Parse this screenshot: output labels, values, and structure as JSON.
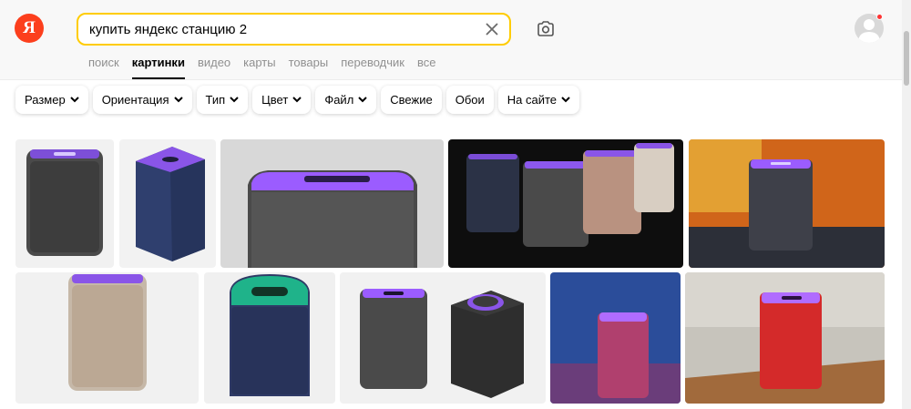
{
  "search": {
    "query": "купить яндекс станцию 2"
  },
  "logo": {
    "letter": "Я"
  },
  "tabs": [
    {
      "label": "поиск",
      "active": false
    },
    {
      "label": "картинки",
      "active": true
    },
    {
      "label": "видео",
      "active": false
    },
    {
      "label": "карты",
      "active": false
    },
    {
      "label": "товары",
      "active": false
    },
    {
      "label": "переводчик",
      "active": false
    },
    {
      "label": "все",
      "active": false
    }
  ],
  "filters": [
    {
      "label": "Размер",
      "dropdown": true
    },
    {
      "label": "Ориентация",
      "dropdown": true
    },
    {
      "label": "Тип",
      "dropdown": true
    },
    {
      "label": "Цвет",
      "dropdown": true
    },
    {
      "label": "Файл",
      "dropdown": true
    },
    {
      "label": "Свежие",
      "dropdown": false
    },
    {
      "label": "Обои",
      "dropdown": false
    },
    {
      "label": "На сайте",
      "dropdown": true
    }
  ],
  "icons": {
    "clear": "close-icon",
    "camera": "camera-search-icon",
    "avatar": "user-avatar-icon"
  },
  "colors": {
    "accent_yellow": "#ffcc00",
    "logo_red": "#fc3f1d",
    "glow_purple": "#9b5cff"
  }
}
